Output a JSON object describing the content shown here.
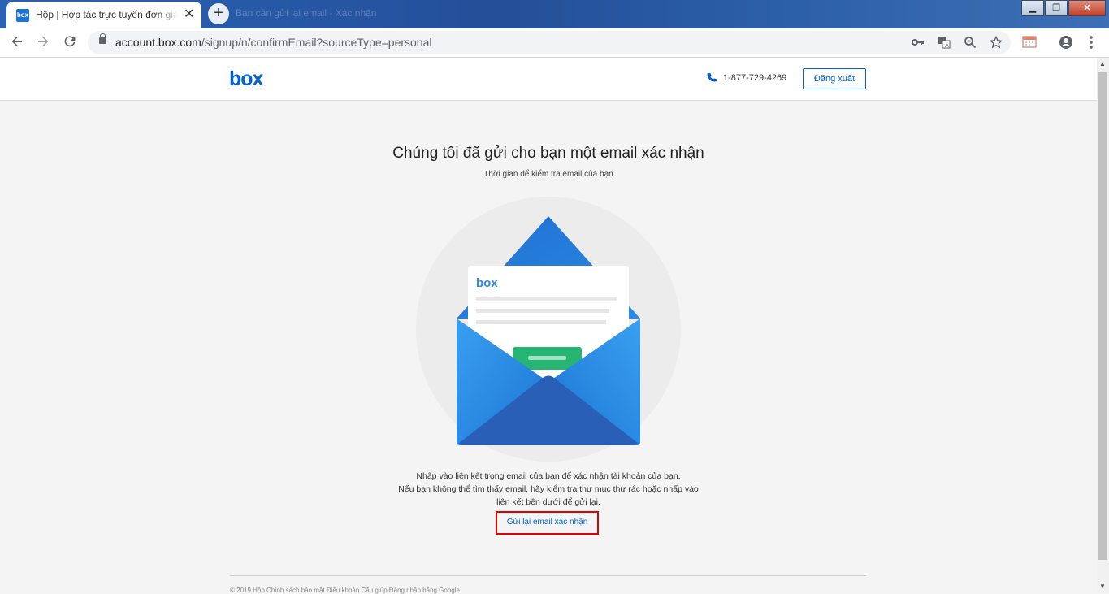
{
  "browser": {
    "tab_title": "Hộp | Hợp tác trực tuyến đơn giản",
    "favicon_text": "box",
    "tab_close": "✕",
    "new_tab": "+",
    "ghost_tab": "Bạn cần gửi lại email - Xác nhận",
    "window_buttons": {
      "minimize": "▁",
      "maximize": "❐",
      "close": "✕"
    },
    "url_host": "account.box.com",
    "url_path": "/signup/n/confirmEmail?sourceType=personal",
    "icons": [
      "back-icon",
      "forward-icon",
      "reload-icon",
      "lock-icon",
      "key-icon",
      "translate-icon",
      "zoom-icon",
      "star-icon",
      "calendar-extension-icon",
      "profile-icon",
      "menu-icon"
    ]
  },
  "header": {
    "logo": "box",
    "phone": "1-877-729-4269",
    "logout_label": "Đăng xuất"
  },
  "main": {
    "headline": "Chúng tôi đã gửi cho bạn một email xác nhận",
    "subheadline": "Thời gian để kiểm tra email của bạn",
    "envelope_logo": "box",
    "body_line1": "Nhấp vào liên kết trong email của bạn để xác nhận tài khoản của bạn.",
    "body_line2": "Nếu bạn không thể tìm thấy email, hãy kiểm tra thư mục thư rác hoặc nhấp vào",
    "body_line3": "liên kết bên dưới để gửi lại.",
    "resend_label": "Gửi lại email xác nhận"
  },
  "footer": {
    "text": "© 2019 Hộp   Chính sách bảo mật   Điều khoản   Câu giúp   Đăng nhập bằng Google"
  },
  "colors": {
    "brand": "#0061d5",
    "highlight_border": "#e00000",
    "envelope_blue": "#2f86e0",
    "envelope_button": "#26b573"
  }
}
